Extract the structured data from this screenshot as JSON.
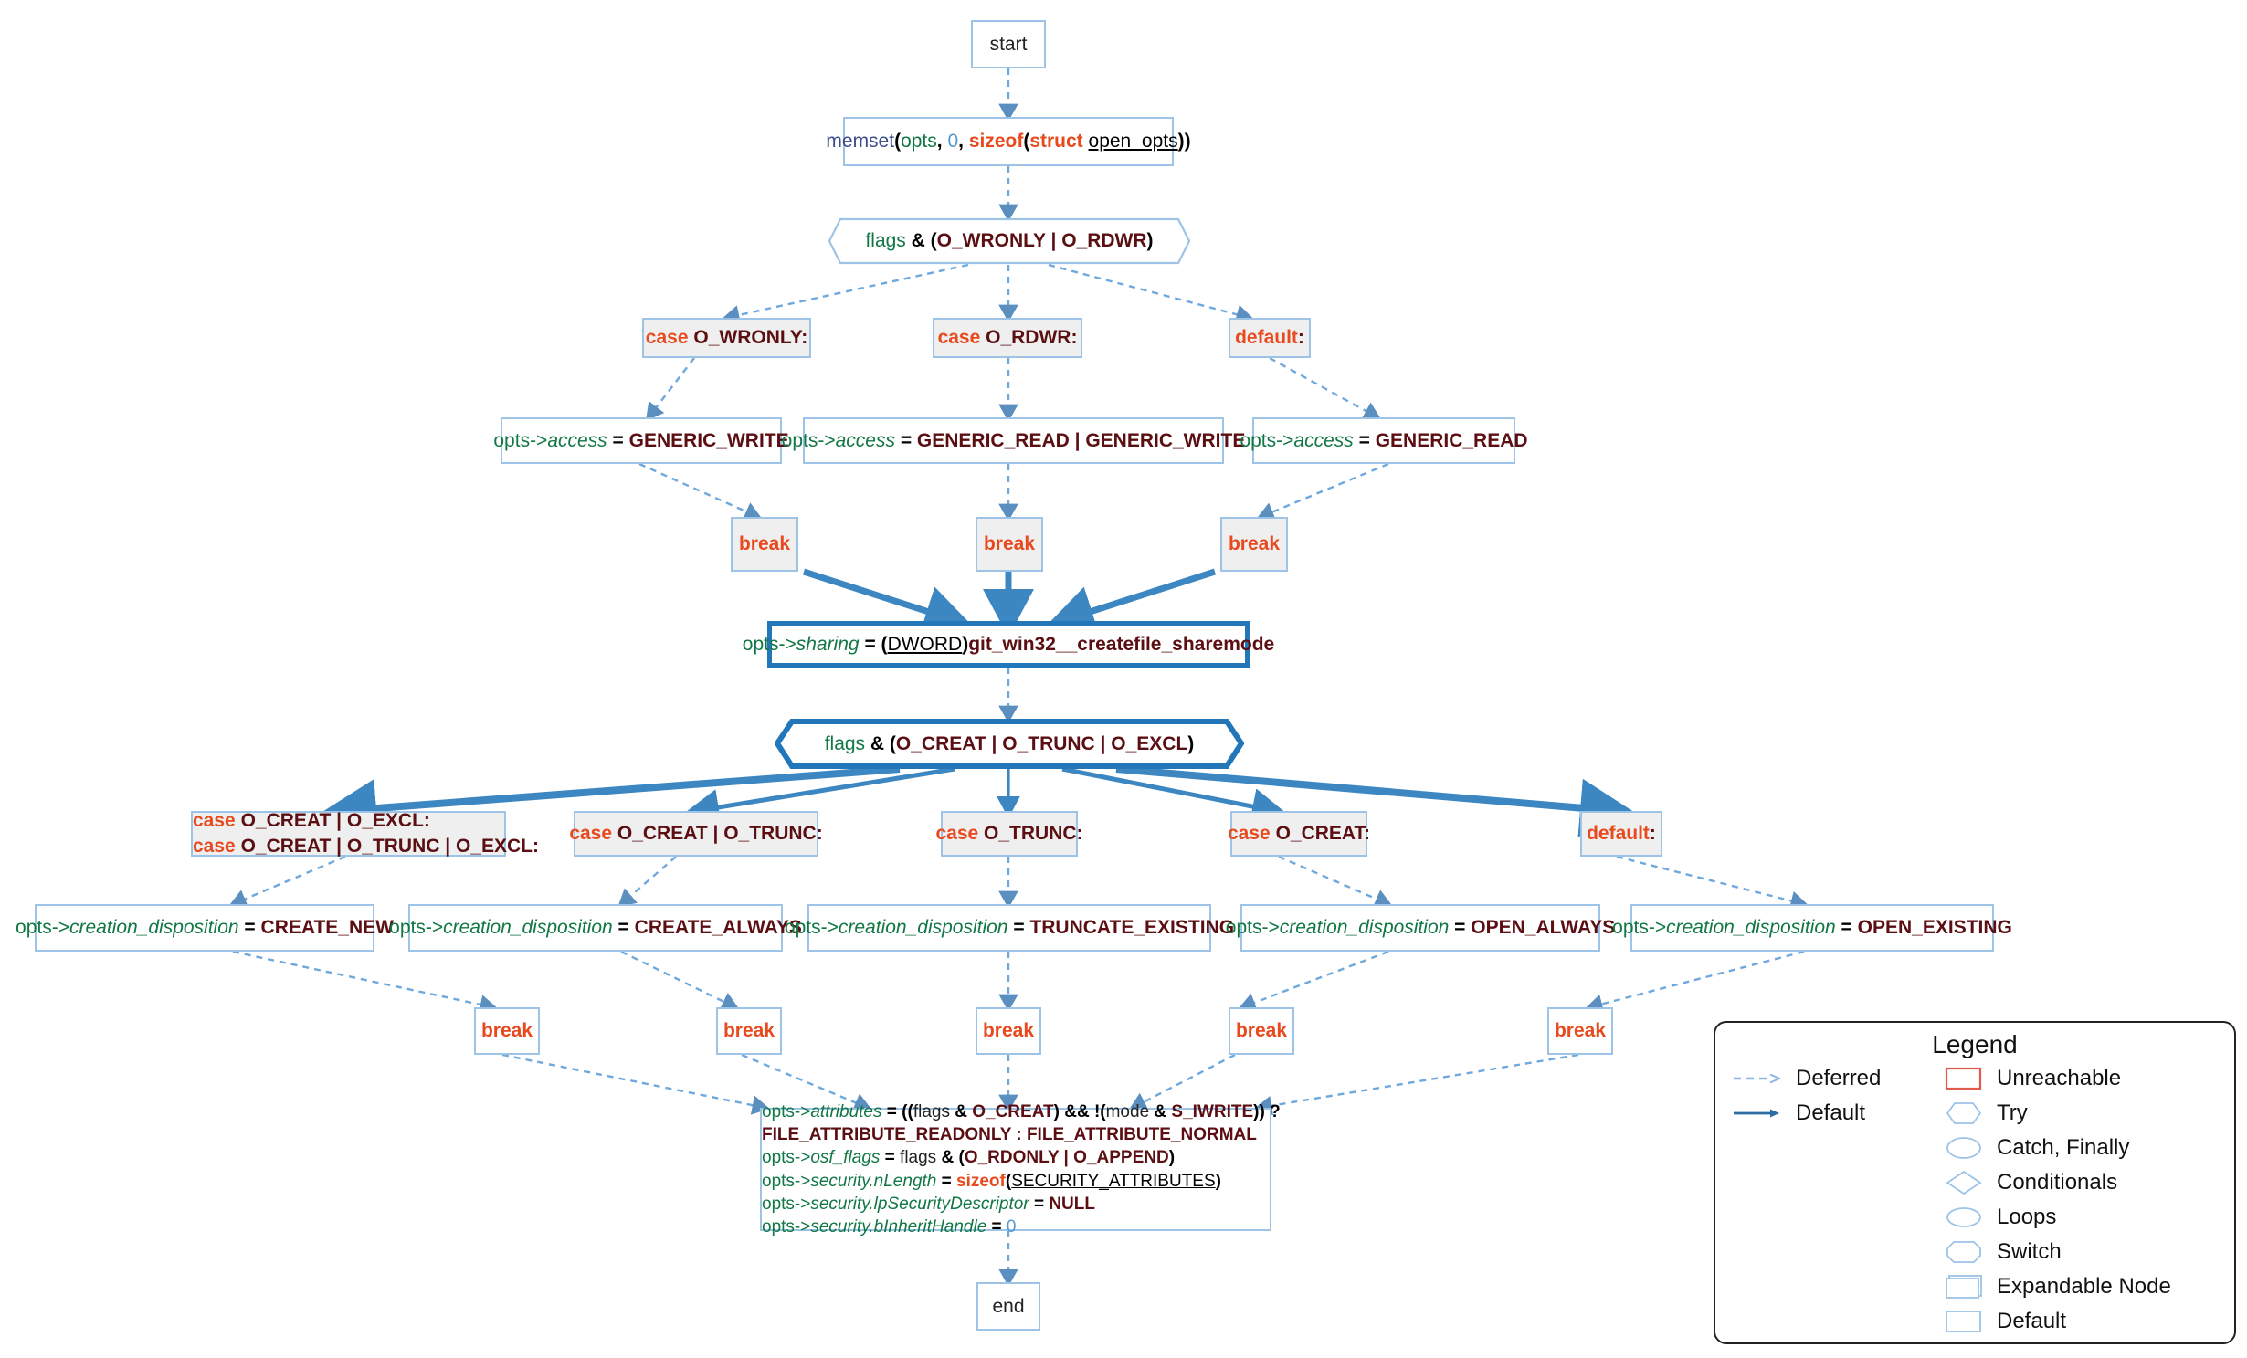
{
  "diagram": {
    "title": "control-flow-graph",
    "colors": {
      "node_border": "#9dc3e6",
      "expandable_border": "#2277bb",
      "case_fill": "#efefef",
      "deferred_edge": "#6fa8dc",
      "default_edge": "#3c87c2",
      "keyword": "#e8491d",
      "identifier": "#117744",
      "constant": "#5b0f12",
      "function": "#3b4a8c",
      "number": "#5599cc",
      "unreachable": "#e05a4e"
    }
  },
  "nodes": {
    "start": {
      "label": "start",
      "shape": "box",
      "kind": "default"
    },
    "memset": {
      "shape": "box",
      "kind": "default",
      "tokens": [
        {
          "t": "memset",
          "c": "fn"
        },
        {
          "t": "(",
          "c": "op"
        },
        {
          "t": "opts",
          "c": "var"
        },
        {
          "t": ", ",
          "c": "op"
        },
        {
          "t": "0",
          "c": "num"
        },
        {
          "t": ", ",
          "c": "op"
        },
        {
          "t": "sizeof",
          "c": "kw"
        },
        {
          "t": "(",
          "c": "op"
        },
        {
          "t": "struct ",
          "c": "kw"
        },
        {
          "t": "open_opts",
          "c": "typ"
        },
        {
          "t": "))",
          "c": "op"
        }
      ],
      "plain": "memset(opts, 0, sizeof(struct open_opts))"
    },
    "switch1": {
      "shape": "switch",
      "kind": "switch",
      "thick": false,
      "tokens": [
        {
          "t": "flags",
          "c": "var"
        },
        {
          "t": " & (",
          "c": "op"
        },
        {
          "t": "O_WRONLY | O_RDWR",
          "c": "cst"
        },
        {
          "t": ")",
          "c": "op"
        }
      ],
      "plain": "flags & (O_WRONLY | O_RDWR)"
    },
    "case_wronly": {
      "shape": "box",
      "kind": "case",
      "tokens": [
        {
          "t": "case ",
          "c": "kw"
        },
        {
          "t": "O_WRONLY:",
          "c": "cst"
        }
      ],
      "plain": "case O_WRONLY:"
    },
    "case_rdwr": {
      "shape": "box",
      "kind": "case",
      "tokens": [
        {
          "t": "case ",
          "c": "kw"
        },
        {
          "t": "O_RDWR:",
          "c": "cst"
        }
      ],
      "plain": "case O_RDWR:"
    },
    "default_1": {
      "shape": "box",
      "kind": "case",
      "tokens": [
        {
          "t": "default",
          "c": "kw"
        },
        {
          "t": ":",
          "c": "cst"
        }
      ],
      "plain": "default:"
    },
    "acc_w": {
      "shape": "box",
      "kind": "default",
      "tokens": [
        {
          "t": "opts->",
          "c": "var"
        },
        {
          "t": "access",
          "c": "mem"
        },
        {
          "t": " = ",
          "c": "op"
        },
        {
          "t": "GENERIC_WRITE",
          "c": "cst"
        }
      ],
      "plain": "opts->access = GENERIC_WRITE"
    },
    "acc_rw": {
      "shape": "box",
      "kind": "default",
      "tokens": [
        {
          "t": "opts->",
          "c": "var"
        },
        {
          "t": "access",
          "c": "mem"
        },
        {
          "t": " = ",
          "c": "op"
        },
        {
          "t": "GENERIC_READ | GENERIC_WRITE",
          "c": "cst"
        }
      ],
      "plain": "opts->access = GENERIC_READ | GENERIC_WRITE"
    },
    "acc_r": {
      "shape": "box",
      "kind": "default",
      "tokens": [
        {
          "t": "opts->",
          "c": "var"
        },
        {
          "t": "access",
          "c": "mem"
        },
        {
          "t": " = ",
          "c": "op"
        },
        {
          "t": "GENERIC_READ",
          "c": "cst"
        }
      ],
      "plain": "opts->access = GENERIC_READ"
    },
    "break_1": {
      "label": "break",
      "shape": "box",
      "kind": "case"
    },
    "break_2": {
      "label": "break",
      "shape": "box",
      "kind": "case"
    },
    "break_3": {
      "label": "break",
      "shape": "box",
      "kind": "case"
    },
    "sharing": {
      "shape": "box",
      "kind": "expandable",
      "thick": true,
      "tokens": [
        {
          "t": "opts->",
          "c": "var"
        },
        {
          "t": "sharing",
          "c": "mem"
        },
        {
          "t": " = (",
          "c": "op"
        },
        {
          "t": "DWORD",
          "c": "typ"
        },
        {
          "t": ")",
          "c": "op"
        },
        {
          "t": "git_win32__createfile_sharemode",
          "c": "cst"
        }
      ],
      "plain": "opts->sharing = (DWORD)git_win32__createfile_sharemode"
    },
    "switch2": {
      "shape": "switch",
      "kind": "switch",
      "thick": true,
      "tokens": [
        {
          "t": "flags",
          "c": "var"
        },
        {
          "t": " & (",
          "c": "op"
        },
        {
          "t": "O_CREAT | O_TRUNC | O_EXCL",
          "c": "cst"
        },
        {
          "t": ")",
          "c": "op"
        }
      ],
      "plain": "flags & (O_CREAT | O_TRUNC | O_EXCL)"
    },
    "case_creat_excl": {
      "shape": "box",
      "kind": "case",
      "multiline": true,
      "lines": [
        [
          {
            "t": "case ",
            "c": "kw"
          },
          {
            "t": "O_CREAT | O_EXCL:",
            "c": "cst"
          }
        ],
        [
          {
            "t": "case ",
            "c": "kw"
          },
          {
            "t": "O_CREAT | O_TRUNC | O_EXCL:",
            "c": "cst"
          }
        ]
      ],
      "plain": "case O_CREAT | O_EXCL:\ncase O_CREAT | O_TRUNC | O_EXCL:"
    },
    "case_creat_trunc": {
      "shape": "box",
      "kind": "case",
      "tokens": [
        {
          "t": "case ",
          "c": "kw"
        },
        {
          "t": "O_CREAT | O_TRUNC:",
          "c": "cst"
        }
      ],
      "plain": "case O_CREAT | O_TRUNC:"
    },
    "case_trunc": {
      "shape": "box",
      "kind": "case",
      "tokens": [
        {
          "t": "case ",
          "c": "kw"
        },
        {
          "t": "O_TRUNC:",
          "c": "cst"
        }
      ],
      "plain": "case O_TRUNC:"
    },
    "case_creat": {
      "shape": "box",
      "kind": "case",
      "tokens": [
        {
          "t": "case ",
          "c": "kw"
        },
        {
          "t": "O_CREAT:",
          "c": "cst"
        }
      ],
      "plain": "case O_CREAT:"
    },
    "default_2": {
      "shape": "box",
      "kind": "case",
      "tokens": [
        {
          "t": "default",
          "c": "kw"
        },
        {
          "t": ":",
          "c": "cst"
        }
      ],
      "plain": "default:"
    },
    "cd_new": {
      "shape": "box",
      "kind": "default",
      "tokens": [
        {
          "t": "opts->",
          "c": "var"
        },
        {
          "t": "creation_disposition",
          "c": "mem"
        },
        {
          "t": " = ",
          "c": "op"
        },
        {
          "t": "CREATE_NEW",
          "c": "cst"
        }
      ],
      "plain": "opts->creation_disposition = CREATE_NEW"
    },
    "cd_always": {
      "shape": "box",
      "kind": "default",
      "tokens": [
        {
          "t": "opts->",
          "c": "var"
        },
        {
          "t": "creation_disposition",
          "c": "mem"
        },
        {
          "t": " = ",
          "c": "op"
        },
        {
          "t": "CREATE_ALWAYS",
          "c": "cst"
        }
      ],
      "plain": "opts->creation_disposition = CREATE_ALWAYS"
    },
    "cd_trunc": {
      "shape": "box",
      "kind": "default",
      "tokens": [
        {
          "t": "opts->",
          "c": "var"
        },
        {
          "t": "creation_disposition",
          "c": "mem"
        },
        {
          "t": " = ",
          "c": "op"
        },
        {
          "t": "TRUNCATE_EXISTING",
          "c": "cst"
        }
      ],
      "plain": "opts->creation_disposition = TRUNCATE_EXISTING"
    },
    "cd_openal": {
      "shape": "box",
      "kind": "default",
      "tokens": [
        {
          "t": "opts->",
          "c": "var"
        },
        {
          "t": "creation_disposition",
          "c": "mem"
        },
        {
          "t": " = ",
          "c": "op"
        },
        {
          "t": "OPEN_ALWAYS",
          "c": "cst"
        }
      ],
      "plain": "opts->creation_disposition = OPEN_ALWAYS"
    },
    "cd_openex": {
      "shape": "box",
      "kind": "default",
      "tokens": [
        {
          "t": "opts->",
          "c": "var"
        },
        {
          "t": "creation_disposition",
          "c": "mem"
        },
        {
          "t": " = ",
          "c": "op"
        },
        {
          "t": "OPEN_EXISTING",
          "c": "cst"
        }
      ],
      "plain": "opts->creation_disposition = OPEN_EXISTING"
    },
    "break_4": {
      "label": "break",
      "shape": "box",
      "kind": "default"
    },
    "break_5": {
      "label": "break",
      "shape": "box",
      "kind": "default"
    },
    "break_6": {
      "label": "break",
      "shape": "box",
      "kind": "default"
    },
    "break_7": {
      "label": "break",
      "shape": "box",
      "kind": "default"
    },
    "break_8": {
      "label": "break",
      "shape": "box",
      "kind": "default"
    },
    "attributes": {
      "shape": "box",
      "kind": "default",
      "multiline": true,
      "lines": [
        [
          {
            "t": "opts->",
            "c": "var"
          },
          {
            "t": "attributes",
            "c": "mem"
          },
          {
            "t": " = ((",
            "c": "op"
          },
          {
            "t": "flags",
            "c": "nrm"
          },
          {
            "t": " & ",
            "c": "op"
          },
          {
            "t": "O_CREAT",
            "c": "cst"
          },
          {
            "t": ") && !(",
            "c": "op"
          },
          {
            "t": "mode",
            "c": "nrm"
          },
          {
            "t": " & ",
            "c": "op"
          },
          {
            "t": "S_IWRITE",
            "c": "cst"
          },
          {
            "t": ")) ?",
            "c": "op"
          }
        ],
        [
          {
            "t": "FILE_ATTRIBUTE_READONLY : FILE_ATTRIBUTE_NORMAL",
            "c": "cst"
          }
        ],
        [
          {
            "t": "opts->",
            "c": "var"
          },
          {
            "t": "osf_flags",
            "c": "mem"
          },
          {
            "t": " = ",
            "c": "op"
          },
          {
            "t": "flags",
            "c": "nrm"
          },
          {
            "t": " & (",
            "c": "op"
          },
          {
            "t": "O_RDONLY | O_APPEND",
            "c": "cst"
          },
          {
            "t": ")",
            "c": "op"
          }
        ],
        [
          {
            "t": "opts->",
            "c": "var"
          },
          {
            "t": "security.nLength",
            "c": "mem"
          },
          {
            "t": " = ",
            "c": "op"
          },
          {
            "t": "sizeof",
            "c": "kw"
          },
          {
            "t": "(",
            "c": "op"
          },
          {
            "t": "SECURITY_ATTRIBUTES",
            "c": "typ"
          },
          {
            "t": ")",
            "c": "op"
          }
        ],
        [
          {
            "t": "opts->",
            "c": "var"
          },
          {
            "t": "security.lpSecurityDescriptor",
            "c": "mem"
          },
          {
            "t": " = ",
            "c": "op"
          },
          {
            "t": "NULL",
            "c": "cst"
          }
        ],
        [
          {
            "t": "opts->",
            "c": "var"
          },
          {
            "t": "security.bInheritHandle",
            "c": "mem"
          },
          {
            "t": " = ",
            "c": "op"
          },
          {
            "t": "0",
            "c": "num"
          }
        ]
      ],
      "plain": "opts->attributes = ((flags & O_CREAT) && !(mode & S_IWRITE)) ? FILE_ATTRIBUTE_READONLY : FILE_ATTRIBUTE_NORMAL; opts->osf_flags = flags & (O_RDONLY | O_APPEND); opts->security.nLength = sizeof(SECURITY_ATTRIBUTES); opts->security.lpSecurityDescriptor = NULL; opts->security.bInheritHandle = 0"
    },
    "end": {
      "label": "end",
      "shape": "box",
      "kind": "default"
    }
  },
  "legend": {
    "title": "Legend",
    "edges": [
      {
        "label": "Deferred",
        "style": "dashed"
      },
      {
        "label": "Default",
        "style": "solid"
      }
    ],
    "shapes": [
      {
        "label": "Unreachable",
        "shape": "rect-red"
      },
      {
        "label": "Try",
        "shape": "hexagon"
      },
      {
        "label": "Catch, Finally",
        "shape": "ellipse"
      },
      {
        "label": "Conditionals",
        "shape": "diamond"
      },
      {
        "label": "Loops",
        "shape": "ellipse-wide"
      },
      {
        "label": "Switch",
        "shape": "octagon"
      },
      {
        "label": "Expandable Node",
        "shape": "rect-stacked"
      },
      {
        "label": "Default",
        "shape": "rect"
      }
    ]
  }
}
